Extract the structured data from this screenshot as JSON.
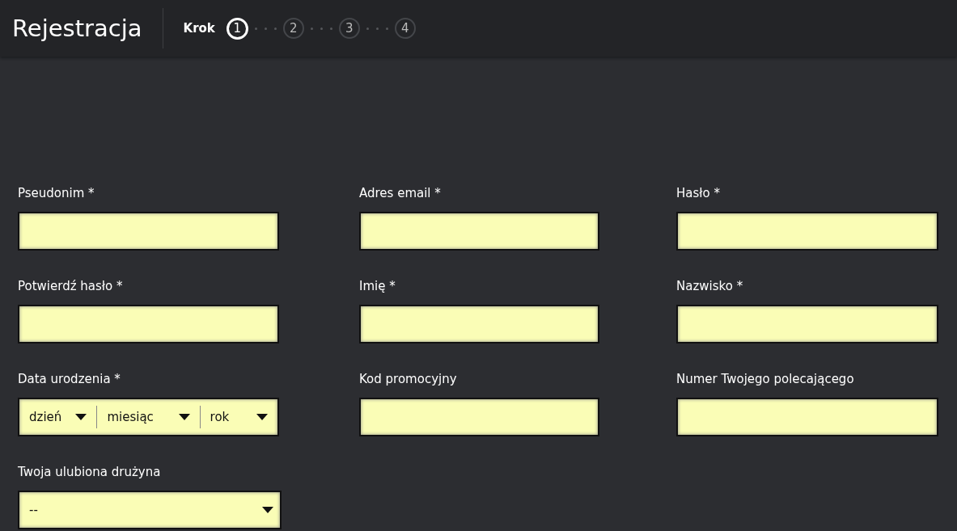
{
  "header": {
    "title": "Rejestracja",
    "step_label": "Krok",
    "steps": [
      {
        "label": "1",
        "selected": true
      },
      {
        "label": "2",
        "selected": false
      },
      {
        "label": "3",
        "selected": false
      },
      {
        "label": "4",
        "selected": false
      }
    ]
  },
  "fields": [
    {
      "kind": "text",
      "label": "Pseudonim *"
    },
    {
      "kind": "text",
      "label": "Adres email *"
    },
    {
      "kind": "text",
      "label": "Hasło *"
    },
    {
      "kind": "text",
      "label": "Potwierdź hasło *"
    },
    {
      "kind": "text",
      "label": "Imię *"
    },
    {
      "kind": "text",
      "label": "Nazwisko *"
    },
    {
      "kind": "date",
      "label": "Data urodzenia *",
      "parts": [
        "dzień",
        "miesiąc",
        "rok"
      ]
    },
    {
      "kind": "text",
      "label": "Kod promocyjny"
    },
    {
      "kind": "text",
      "label": "Numer Twojego polecającego"
    },
    {
      "kind": "select",
      "label": "Twoja ulubiona drużyna",
      "value": "--"
    }
  ]
}
